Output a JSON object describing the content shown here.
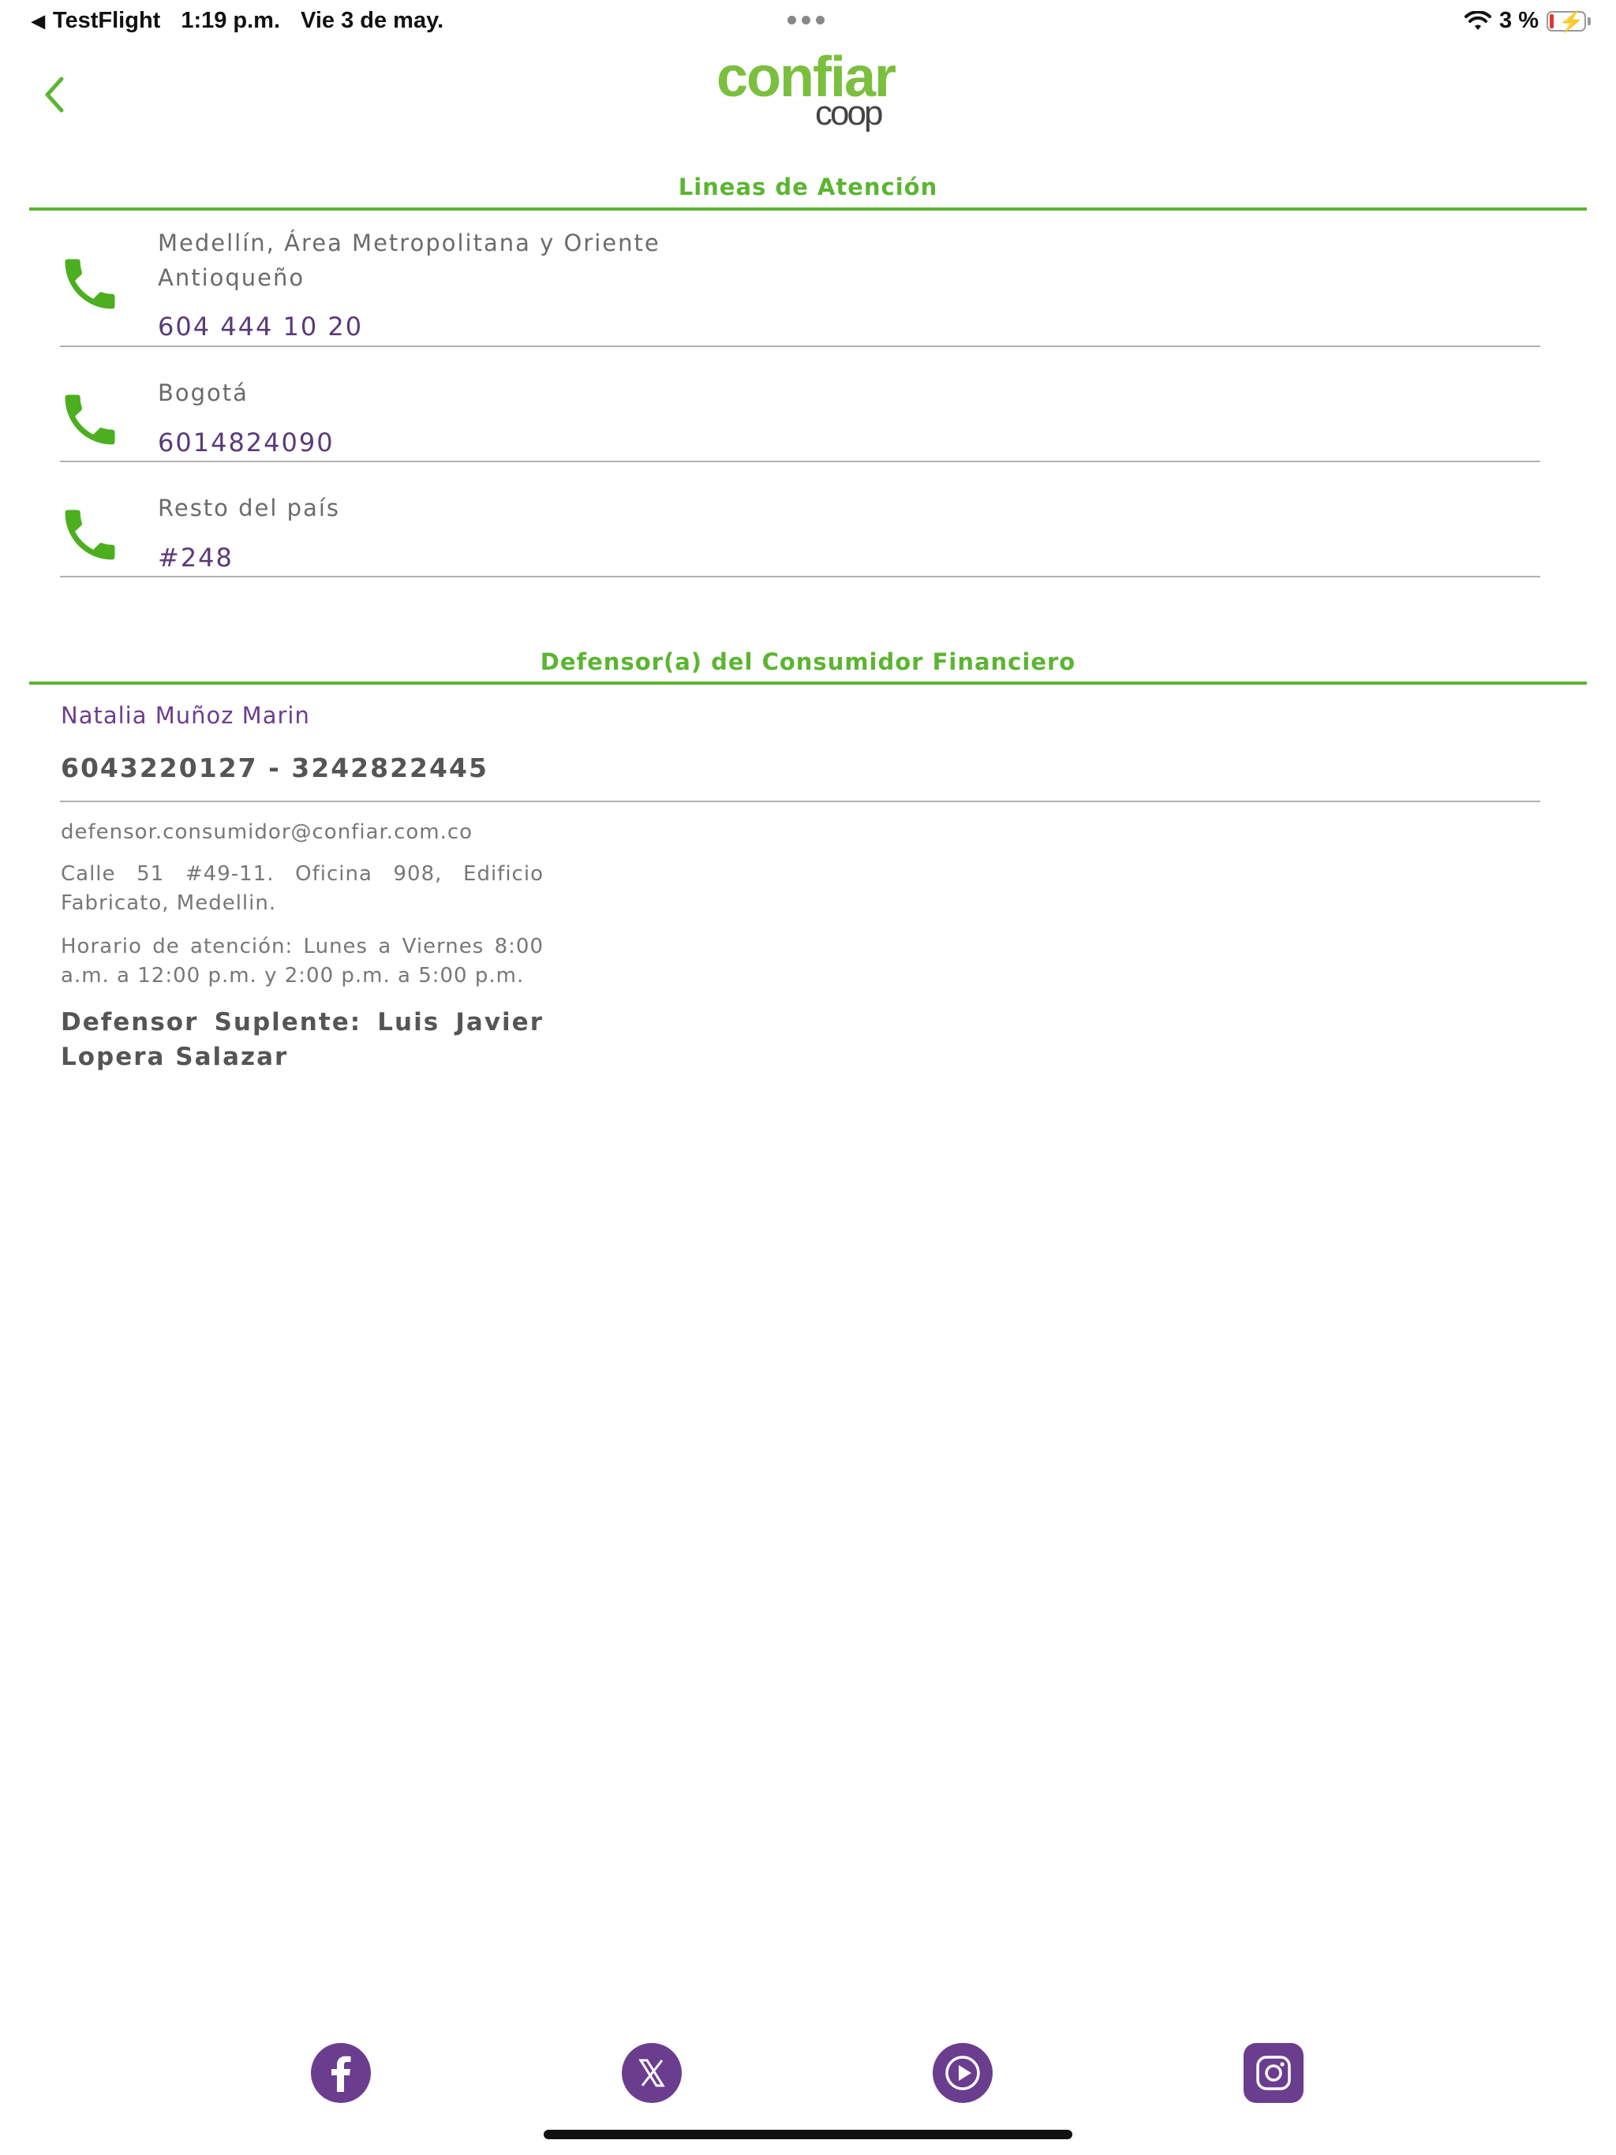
{
  "status_bar": {
    "back_app": "TestFlight",
    "time": "1:19 p.m.",
    "date": "Vie 3 de may.",
    "battery": "3 %",
    "battery_level": 0.03
  },
  "header": {
    "logo_main": "confiar",
    "logo_sub": "coop"
  },
  "lines_section": {
    "title": "Lineas de Atención",
    "items": [
      {
        "label_line1": "Medellín, Área Metropolitana y Oriente",
        "label_line2": "Antioqueño",
        "number": "604 444 10 20"
      },
      {
        "label_line1": "Bogotá",
        "number": "6014824090"
      },
      {
        "label_line1": "Resto del país",
        "number": "#248"
      }
    ]
  },
  "defensor_section": {
    "title": "Defensor(a) del Consumidor Financiero",
    "name": "Natalia Muñoz Marin",
    "phones": "6043220127 - 3242822445",
    "email": "defensor.consumidor@confiar.com.co",
    "address": "Calle 51 #49-11. Oficina 908, Edificio Fabricato, Medellin.",
    "hours": "Horario de atención: Lunes a Viernes 8:00 a.m. a 12:00 p.m. y 2:00 p.m. a 5:00 p.m.",
    "suplente": "Defensor Suplente: Luis Javier Lopera Salazar"
  },
  "social": {
    "icons": [
      "facebook-icon",
      "x-icon",
      "youtube-play-icon",
      "instagram-icon"
    ],
    "color": "#6b3d8f"
  },
  "colors": {
    "accent_green": "#5bb531",
    "accent_purple": "#6b3d8f"
  }
}
